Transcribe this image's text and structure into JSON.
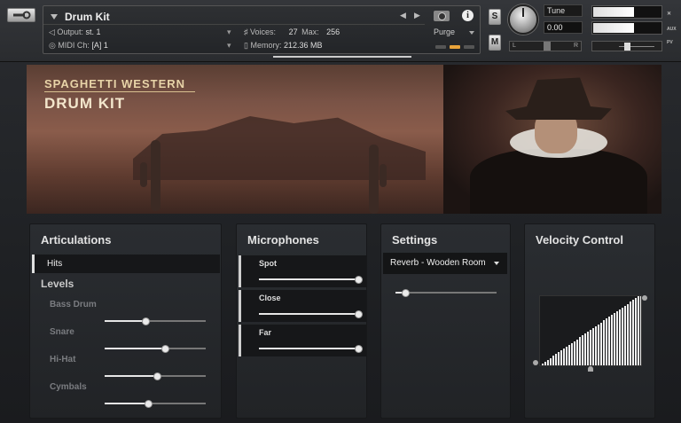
{
  "header": {
    "instrument_name": "Drum Kit",
    "output_label": "Output:",
    "output_value": "st. 1",
    "midi_label": "MIDI Ch:",
    "midi_value": "[A] 1",
    "voices_label": "Voices:",
    "voices_value": "27",
    "max_label": "Max:",
    "max_value": "256",
    "memory_label": "Memory:",
    "memory_value": "212.36 MB",
    "purge_label": "Purge",
    "solo_label": "S",
    "mute_label": "M",
    "tune_label": "Tune",
    "tune_value": "0.00",
    "pan_left": "L",
    "pan_right": "R",
    "side_aux": "AUX",
    "side_pv": "PV"
  },
  "banner": {
    "title_line1": "SPAGHETTI WESTERN",
    "title_line2": "DRUM KIT"
  },
  "articulations": {
    "title": "Articulations",
    "selected": "Hits",
    "levels_title": "Levels",
    "levels": [
      {
        "label": "Bass Drum",
        "value": 0.4
      },
      {
        "label": "Snare",
        "value": 0.6
      },
      {
        "label": "Hi-Hat",
        "value": 0.52
      },
      {
        "label": "Cymbals",
        "value": 0.43
      }
    ]
  },
  "microphones": {
    "title": "Microphones",
    "mics": [
      {
        "label": "Spot",
        "value": 1.0
      },
      {
        "label": "Close",
        "value": 1.0
      },
      {
        "label": "Far",
        "value": 1.0
      }
    ]
  },
  "settings": {
    "title": "Settings",
    "reverb_selected": "Reverb - Wooden Room",
    "reverb_amount": 0.1
  },
  "velocity": {
    "title": "Velocity Control",
    "curve": "linear"
  },
  "colors": {
    "accent": "#e6e6e6",
    "panel": "#25272a",
    "led_orange": "#e8a33a"
  }
}
